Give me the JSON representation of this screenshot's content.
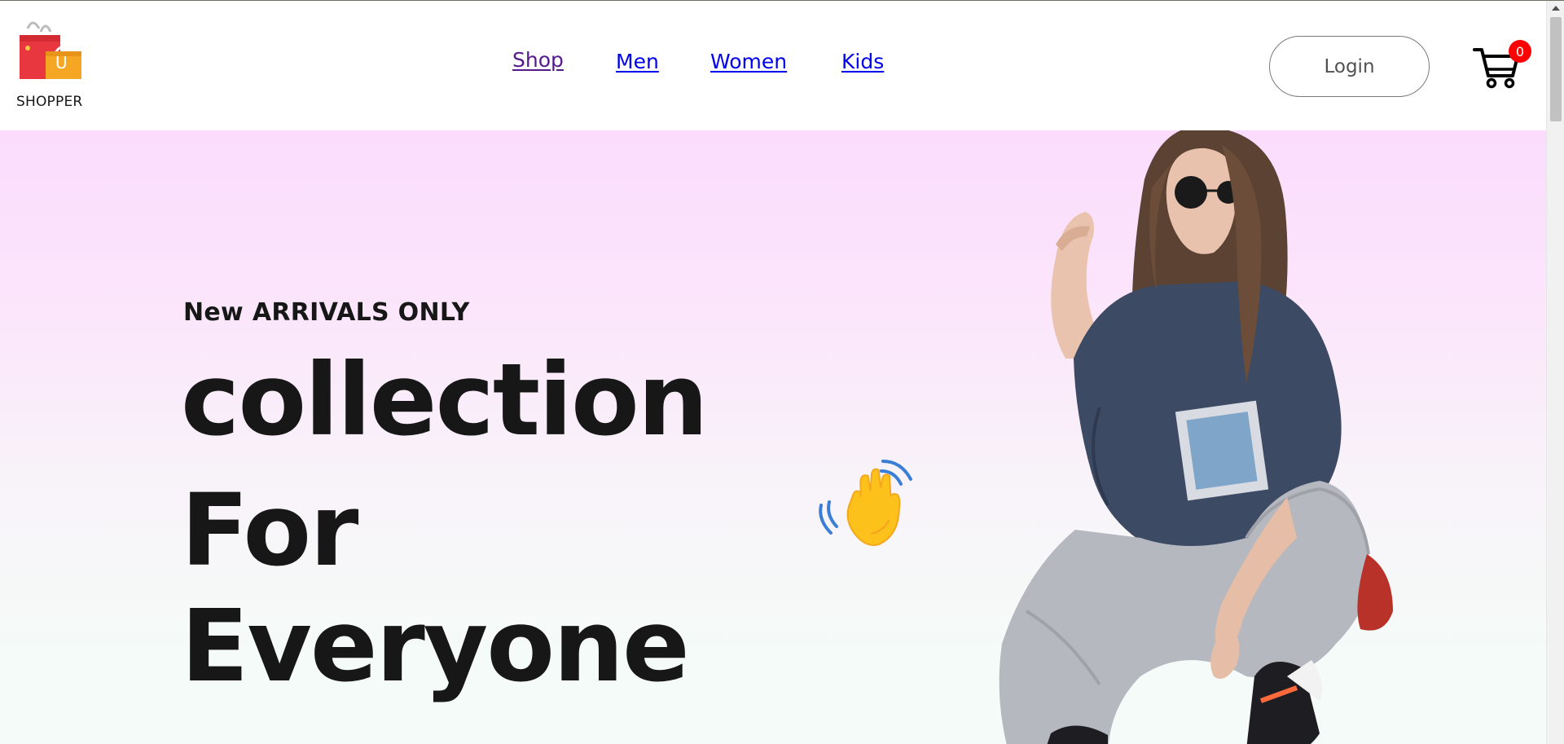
{
  "brand": {
    "name": "SHOPPER",
    "logo_letter": "U"
  },
  "nav": {
    "items": [
      {
        "label": "Shop"
      },
      {
        "label": "Men"
      },
      {
        "label": "Women"
      },
      {
        "label": "Kids"
      }
    ]
  },
  "header": {
    "login_label": "Login",
    "cart_count": "0"
  },
  "hero": {
    "kicker": "New ARRIVALS ONLY",
    "lines": [
      "collection",
      "For",
      "Everyone"
    ]
  },
  "colors": {
    "link": "#0000ee",
    "visited_link": "#551a8b",
    "cart_badge": "#ff0000",
    "hero_top": "#fbdcfd",
    "hero_bottom": "#f5fbf8",
    "text": "#171717"
  },
  "icons": {
    "logo": "shopping-bags-icon",
    "cart": "cart-icon",
    "wave": "waving-hand-icon"
  }
}
